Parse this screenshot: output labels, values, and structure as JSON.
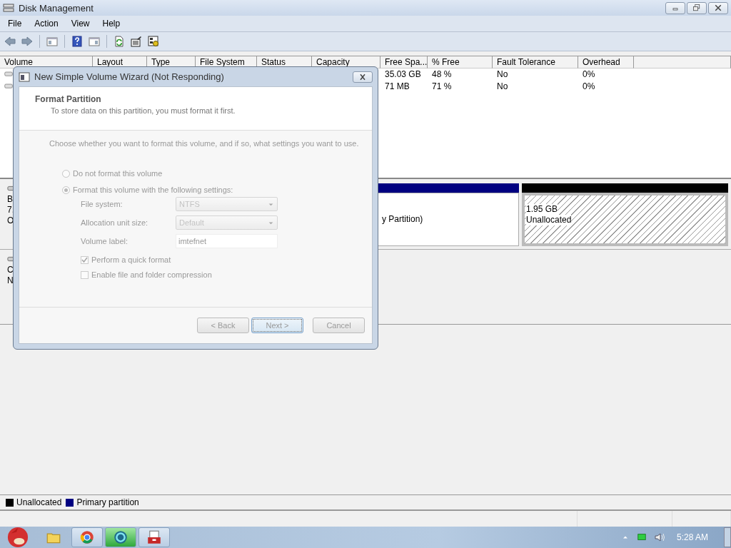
{
  "window": {
    "title": "Disk Management"
  },
  "menu": [
    "File",
    "Action",
    "View",
    "Help"
  ],
  "volume_table": {
    "columns": [
      "Volume",
      "Layout",
      "Type",
      "File System",
      "Status",
      "Capacity",
      "Free Spa...",
      "% Free",
      "Fault Tolerance",
      "Overhead"
    ],
    "rows": [
      {
        "free_space": "35.03 GB",
        "percent_free": "48 %",
        "fault_tolerance": "No",
        "overhead": "0%"
      },
      {
        "free_space": "71 MB",
        "percent_free": "71 %",
        "fault_tolerance": "No",
        "overhead": "0%"
      }
    ]
  },
  "disks": [
    {
      "label_lines": [
        "B",
        "7.",
        "O"
      ],
      "partitions": [
        {
          "kind": "primary",
          "color": "#000080",
          "lines": [
            "y Partition)"
          ]
        },
        {
          "kind": "unallocated",
          "color": "#000000",
          "lines": [
            "1.95 GB",
            "Unallocated"
          ]
        }
      ]
    },
    {
      "label_lines": [
        "C",
        "N"
      ]
    }
  ],
  "legend": [
    {
      "label": "Unallocated",
      "color": "#000000"
    },
    {
      "label": "Primary partition",
      "color": "#000080"
    }
  ],
  "dialog": {
    "title": "New Simple Volume Wizard (Not Responding)",
    "heading": "Format Partition",
    "subheading": "To store data on this partition, you must format it first.",
    "instruction": "Choose whether you want to format this volume, and if so, what settings you want to use.",
    "disabled": true,
    "options": [
      {
        "label": "Do not format this volume",
        "selected": false
      },
      {
        "label": "Format this volume with the following settings:",
        "selected": true
      }
    ],
    "fields": [
      {
        "kind": "select",
        "label": "File system:",
        "value": "NTFS"
      },
      {
        "kind": "select",
        "label": "Allocation unit size:",
        "value": "Default"
      },
      {
        "kind": "text",
        "label": "Volume label:",
        "value": "imtefnet"
      }
    ],
    "checkboxes": [
      {
        "label": "Perform a quick format",
        "checked": true
      },
      {
        "label": "Enable file and folder compression",
        "checked": false
      }
    ],
    "buttons": [
      {
        "label": "< Back",
        "default": false
      },
      {
        "label": "Next >",
        "default": true
      },
      {
        "label": "Cancel",
        "default": false
      }
    ]
  },
  "taskbar": {
    "apps": [
      {
        "kind": "folder",
        "selected": false
      },
      {
        "kind": "browser",
        "selected": false
      },
      {
        "kind": "orb",
        "selected": true
      },
      {
        "kind": "toolbox",
        "selected": false
      }
    ],
    "clock": "5:28 AM"
  }
}
